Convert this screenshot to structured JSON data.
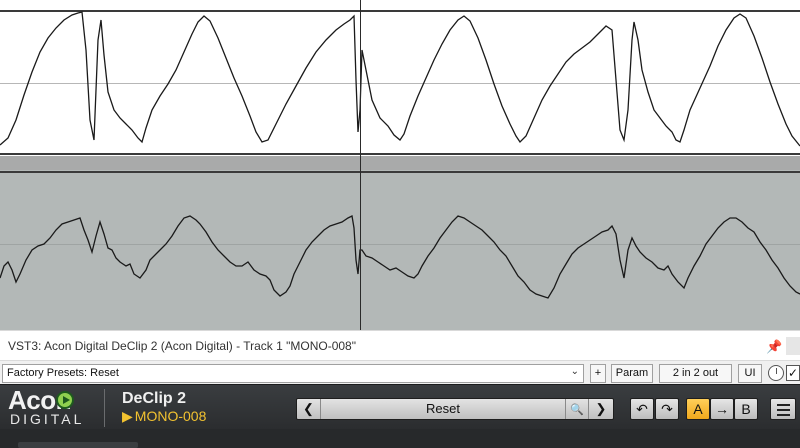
{
  "host": {
    "plugin_title": "VST3: Acon Digital DeClip 2 (Acon Digital) - Track 1 \"MONO-008\"",
    "preset_value": "Factory Presets: Reset",
    "plus_label": "+",
    "param_label": "Param",
    "routing_label": "2 in 2 out",
    "ui_label": "UI",
    "checkbox_mark": "✓"
  },
  "plugin": {
    "logo_top": "Acon",
    "logo_bottom": "DIGITAL",
    "name": "DeClip 2",
    "track_marker": "▶",
    "track": "MONO-008",
    "preset": {
      "prev": "❮",
      "label": "Reset",
      "search": "🔍",
      "next": "❯"
    },
    "undo": "↶",
    "redo": "↷",
    "ab": {
      "a": "A",
      "arrow": "→",
      "b": "B"
    }
  },
  "colors": {
    "accent": "#f2c230",
    "header_bg": "#2f3133",
    "active_button": "#f0a81c"
  }
}
